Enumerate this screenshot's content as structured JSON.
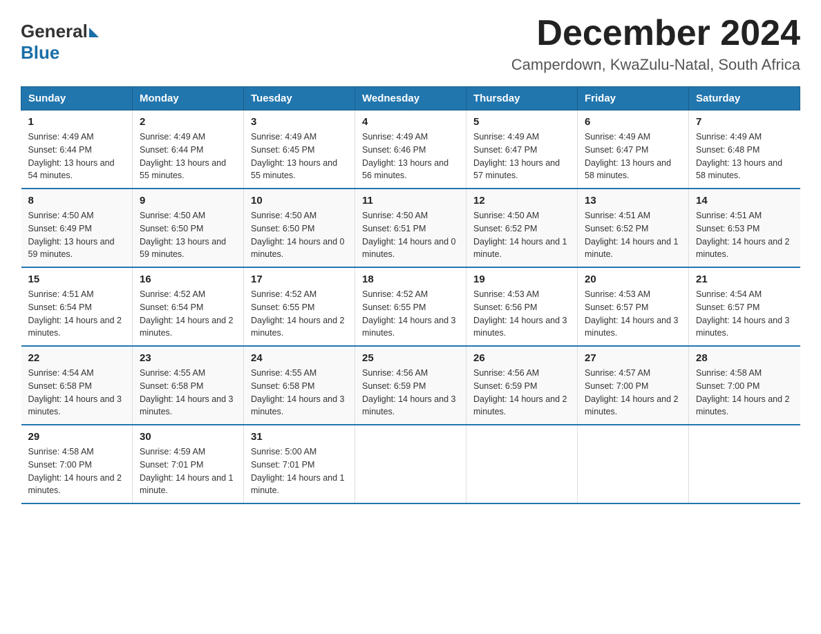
{
  "logo": {
    "general": "General",
    "blue": "Blue"
  },
  "title": "December 2024",
  "subtitle": "Camperdown, KwaZulu-Natal, South Africa",
  "days_of_week": [
    "Sunday",
    "Monday",
    "Tuesday",
    "Wednesday",
    "Thursday",
    "Friday",
    "Saturday"
  ],
  "weeks": [
    [
      {
        "day": "1",
        "sunrise": "4:49 AM",
        "sunset": "6:44 PM",
        "daylight": "13 hours and 54 minutes."
      },
      {
        "day": "2",
        "sunrise": "4:49 AM",
        "sunset": "6:44 PM",
        "daylight": "13 hours and 55 minutes."
      },
      {
        "day": "3",
        "sunrise": "4:49 AM",
        "sunset": "6:45 PM",
        "daylight": "13 hours and 55 minutes."
      },
      {
        "day": "4",
        "sunrise": "4:49 AM",
        "sunset": "6:46 PM",
        "daylight": "13 hours and 56 minutes."
      },
      {
        "day": "5",
        "sunrise": "4:49 AM",
        "sunset": "6:47 PM",
        "daylight": "13 hours and 57 minutes."
      },
      {
        "day": "6",
        "sunrise": "4:49 AM",
        "sunset": "6:47 PM",
        "daylight": "13 hours and 58 minutes."
      },
      {
        "day": "7",
        "sunrise": "4:49 AM",
        "sunset": "6:48 PM",
        "daylight": "13 hours and 58 minutes."
      }
    ],
    [
      {
        "day": "8",
        "sunrise": "4:50 AM",
        "sunset": "6:49 PM",
        "daylight": "13 hours and 59 minutes."
      },
      {
        "day": "9",
        "sunrise": "4:50 AM",
        "sunset": "6:50 PM",
        "daylight": "13 hours and 59 minutes."
      },
      {
        "day": "10",
        "sunrise": "4:50 AM",
        "sunset": "6:50 PM",
        "daylight": "14 hours and 0 minutes."
      },
      {
        "day": "11",
        "sunrise": "4:50 AM",
        "sunset": "6:51 PM",
        "daylight": "14 hours and 0 minutes."
      },
      {
        "day": "12",
        "sunrise": "4:50 AM",
        "sunset": "6:52 PM",
        "daylight": "14 hours and 1 minute."
      },
      {
        "day": "13",
        "sunrise": "4:51 AM",
        "sunset": "6:52 PM",
        "daylight": "14 hours and 1 minute."
      },
      {
        "day": "14",
        "sunrise": "4:51 AM",
        "sunset": "6:53 PM",
        "daylight": "14 hours and 2 minutes."
      }
    ],
    [
      {
        "day": "15",
        "sunrise": "4:51 AM",
        "sunset": "6:54 PM",
        "daylight": "14 hours and 2 minutes."
      },
      {
        "day": "16",
        "sunrise": "4:52 AM",
        "sunset": "6:54 PM",
        "daylight": "14 hours and 2 minutes."
      },
      {
        "day": "17",
        "sunrise": "4:52 AM",
        "sunset": "6:55 PM",
        "daylight": "14 hours and 2 minutes."
      },
      {
        "day": "18",
        "sunrise": "4:52 AM",
        "sunset": "6:55 PM",
        "daylight": "14 hours and 3 minutes."
      },
      {
        "day": "19",
        "sunrise": "4:53 AM",
        "sunset": "6:56 PM",
        "daylight": "14 hours and 3 minutes."
      },
      {
        "day": "20",
        "sunrise": "4:53 AM",
        "sunset": "6:57 PM",
        "daylight": "14 hours and 3 minutes."
      },
      {
        "day": "21",
        "sunrise": "4:54 AM",
        "sunset": "6:57 PM",
        "daylight": "14 hours and 3 minutes."
      }
    ],
    [
      {
        "day": "22",
        "sunrise": "4:54 AM",
        "sunset": "6:58 PM",
        "daylight": "14 hours and 3 minutes."
      },
      {
        "day": "23",
        "sunrise": "4:55 AM",
        "sunset": "6:58 PM",
        "daylight": "14 hours and 3 minutes."
      },
      {
        "day": "24",
        "sunrise": "4:55 AM",
        "sunset": "6:58 PM",
        "daylight": "14 hours and 3 minutes."
      },
      {
        "day": "25",
        "sunrise": "4:56 AM",
        "sunset": "6:59 PM",
        "daylight": "14 hours and 3 minutes."
      },
      {
        "day": "26",
        "sunrise": "4:56 AM",
        "sunset": "6:59 PM",
        "daylight": "14 hours and 2 minutes."
      },
      {
        "day": "27",
        "sunrise": "4:57 AM",
        "sunset": "7:00 PM",
        "daylight": "14 hours and 2 minutes."
      },
      {
        "day": "28",
        "sunrise": "4:58 AM",
        "sunset": "7:00 PM",
        "daylight": "14 hours and 2 minutes."
      }
    ],
    [
      {
        "day": "29",
        "sunrise": "4:58 AM",
        "sunset": "7:00 PM",
        "daylight": "14 hours and 2 minutes."
      },
      {
        "day": "30",
        "sunrise": "4:59 AM",
        "sunset": "7:01 PM",
        "daylight": "14 hours and 1 minute."
      },
      {
        "day": "31",
        "sunrise": "5:00 AM",
        "sunset": "7:01 PM",
        "daylight": "14 hours and 1 minute."
      },
      null,
      null,
      null,
      null
    ]
  ]
}
